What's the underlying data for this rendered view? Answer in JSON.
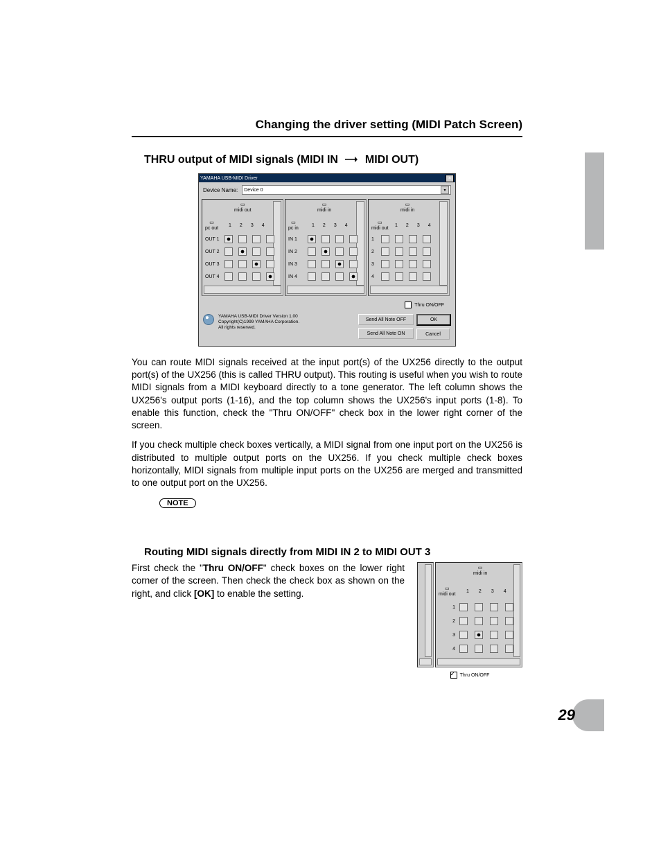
{
  "header": {
    "title": "Changing the driver setting (MIDI Patch Screen)"
  },
  "section1": {
    "subhead_pre": "THRU output of MIDI signals (MIDI IN",
    "subhead_post": "MIDI OUT)",
    "para1": "You can route MIDI signals received at the input port(s) of the UX256 directly to the output port(s) of the UX256 (this is called THRU output). This routing is useful when you wish to route MIDI signals from a MIDI keyboard directly to a tone generator. The left column shows the UX256's output ports (1-16), and the top column shows the UX256's input ports (1-8). To enable this function, check the \"Thru ON/OFF\" check box in the lower right corner of the screen.",
    "para2": "If you check multiple check boxes vertically, a MIDI signal from one input port on the UX256 is distributed to multiple output ports on the UX256. If you check multiple check boxes horizontally, MIDI signals from multiple input ports on the UX256 are merged and transmitted to one output port on the UX256.",
    "note": "NOTE"
  },
  "dialog": {
    "title": "YAMAHA USB-MIDI Driver",
    "device_label": "Device Name:",
    "device_value": "Device 0",
    "panel_headers": {
      "left_top": "midi out",
      "left_side": "pc out",
      "mid_top": "midi in",
      "mid_side": "pc in",
      "right_top": "midi in",
      "right_side": "midi out"
    },
    "cols": [
      "1",
      "2",
      "3",
      "4"
    ],
    "left_rows": [
      "OUT  1",
      "OUT  2",
      "OUT  3",
      "OUT  4"
    ],
    "mid_rows": [
      "IN     1",
      "IN     2",
      "IN     3",
      "IN     4"
    ],
    "right_rows": [
      "1",
      "2",
      "3",
      "4"
    ],
    "thru_label": "Thru ON/OFF",
    "version_lines": [
      "YAMAHA USB-MIDI Driver Version 1.00",
      "Copyright(C)1999 YAMAHA Corporation.",
      "All rights reserved."
    ],
    "buttons": {
      "send_off": "Send All Note OFF",
      "send_on": "Send All Note ON",
      "ok": "OK",
      "cancel": "Cancel"
    }
  },
  "section2": {
    "subhead": "Routing MIDI signals directly from MIDI IN 2 to MIDI OUT 3",
    "text_parts": {
      "p1": "First check the \"",
      "b1": "Thru ON/OFF",
      "p2": "\" check boxes on the lower right corner of the screen. Then check the check box as shown on the right, and click ",
      "b2": "[OK]",
      "p3": " to enable the setting."
    },
    "mini": {
      "top": "midi in",
      "side": "midi out",
      "cols": [
        "1",
        "2",
        "3",
        "4"
      ],
      "rows": [
        "1",
        "2",
        "3",
        "4"
      ],
      "checked_row": 3,
      "checked_col": 2,
      "thru_label": "Thru ON/OFF"
    }
  },
  "page_number": "29"
}
